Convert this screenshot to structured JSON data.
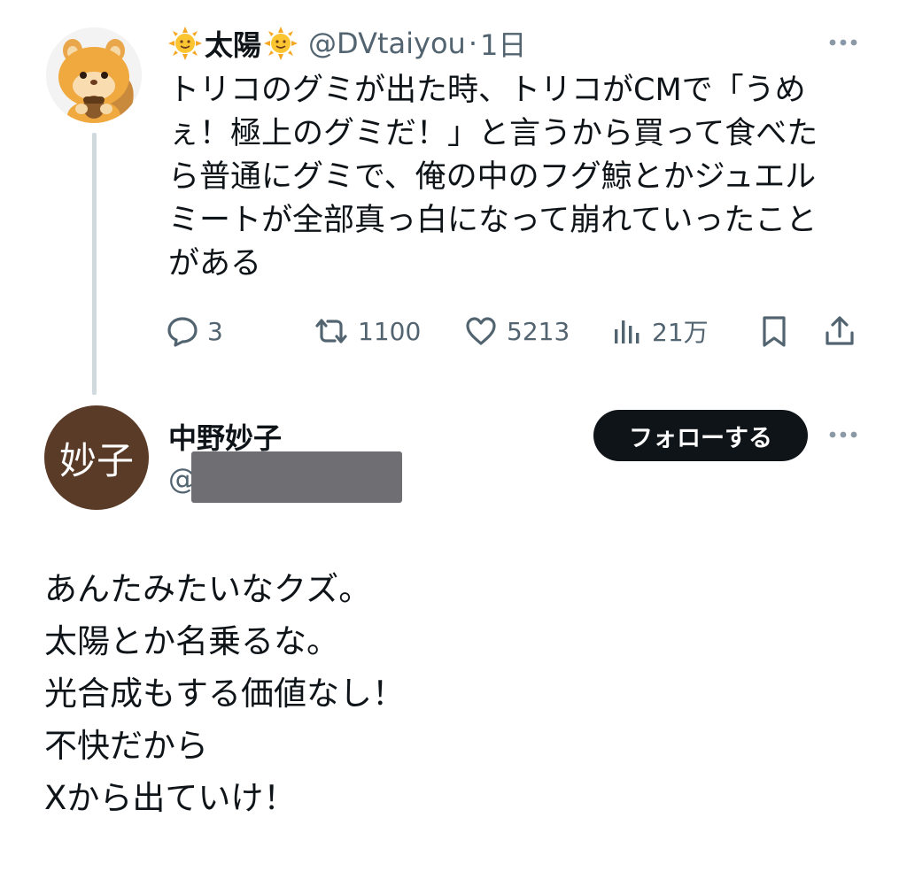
{
  "tweet": {
    "display_name": "太陽",
    "handle": "@DVtaiyou",
    "separator": "·",
    "time": "1日",
    "text": "トリコのグミが出た時、トリコがCMで「うめぇ！極上のグミだ！」と言うから買って食べたら普通にグミで、俺の中のフグ鯨とかジュエルミートが全部真っ白になって崩れていったことがある",
    "text_lines": [
      "トリコのグミが出た時、トリコがCMで「うめ",
      "ぇ！極上のグミだ！」と言うから買って食べた",
      "ら普通にグミで、俺の中のフグ鯨とかジュエル",
      "ミートが全部真っ白になって崩れていったこと",
      "がある"
    ],
    "stats": {
      "replies": "3",
      "retweets": "1100",
      "likes": "5213",
      "views": "21万"
    },
    "icons": {
      "name_decoration": "sun-icon",
      "more": "more-icon",
      "reply": "reply-icon",
      "retweet": "retweet-icon",
      "like": "heart-icon",
      "views": "views-icon",
      "bookmark": "bookmark-icon",
      "share": "share-icon"
    }
  },
  "reply": {
    "display_name": "中野妙子",
    "avatar_text": "妙子",
    "handle_prefix": "@",
    "follow_label": "フォローする",
    "lines": [
      "あんたみたいなクズ。",
      "太陽とか名乗るな。",
      "光合成もする価値なし！",
      "不快だから",
      "Xから出ていけ！"
    ]
  },
  "colors": {
    "text_primary": "#0f1419",
    "text_secondary": "#536471",
    "thread_line": "#cfd9de",
    "follow_button_bg": "#0f1419",
    "avatar2_bg": "#5a3b28",
    "redaction": "#6f6f73"
  }
}
